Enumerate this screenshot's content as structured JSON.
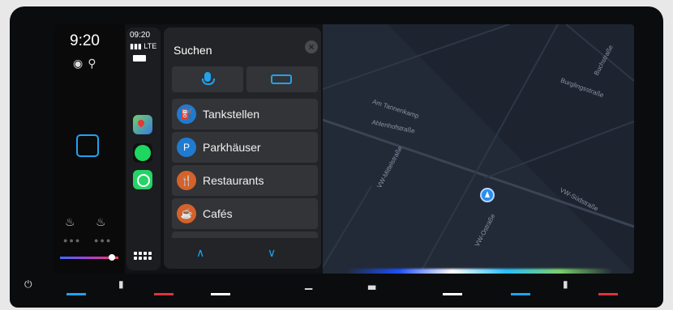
{
  "status": {
    "clock": "9:20",
    "dock_time": "09:20",
    "network": "LTE"
  },
  "search": {
    "title": "Suchen"
  },
  "categories": [
    {
      "label": "Tankstellen",
      "icon": "fuel-icon",
      "glyph": "⛽",
      "color": "#1f7bd0"
    },
    {
      "label": "Parkhäuser",
      "icon": "parking-icon",
      "glyph": "P",
      "color": "#1f7bd0"
    },
    {
      "label": "Restaurants",
      "icon": "restaurant-icon",
      "glyph": "🍴",
      "color": "#d4622a"
    },
    {
      "label": "Cafés",
      "icon": "cafe-icon",
      "glyph": "☕",
      "color": "#d4622a"
    }
  ],
  "map": {
    "streets": [
      "Am Tannenkamp",
      "Ahlenhofstraße",
      "VW-Mittelstraße",
      "VW-Ostraße",
      "Burglingsstraße",
      "VW-Südstraße",
      "Buchstraße"
    ]
  },
  "colors": {
    "accent": "#1fa3ef",
    "panel": "#232427",
    "map": "#1d2430"
  }
}
